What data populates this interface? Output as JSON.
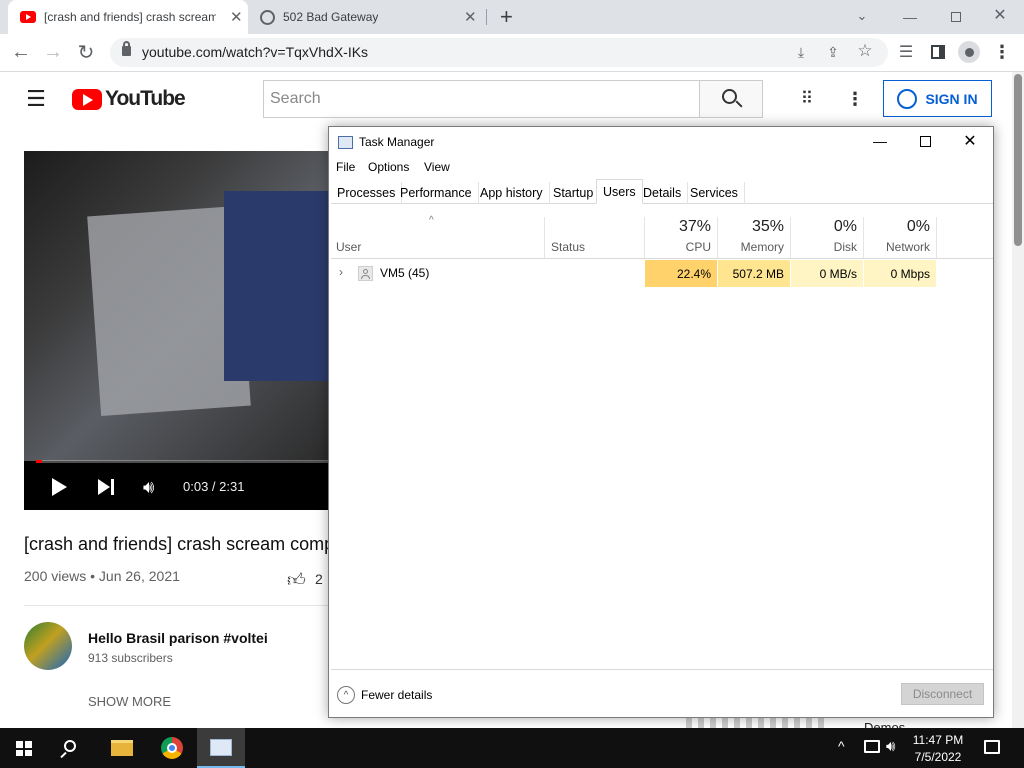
{
  "browser": {
    "tabs": [
      {
        "title": "[crash and friends] crash scream",
        "active": true
      },
      {
        "title": "502 Bad Gateway",
        "active": false
      }
    ],
    "new_tab": "+",
    "url": "youtube.com/watch?v=TqxVhdX-IKs"
  },
  "youtube": {
    "logo_text": "YouTube",
    "search_placeholder": "Search",
    "sign_in": "SIGN IN",
    "video": {
      "time": "0:03 / 2:31",
      "progress": 0.02,
      "title": "[crash and friends] crash scream comp",
      "meta": "200 views • Jun 26, 2021",
      "likes": "2"
    },
    "channel": {
      "name": "Hello Brasil parison #voltei",
      "subscribers": "913 subscribers"
    },
    "show_more": "SHOW MORE",
    "peek_text": "Demos"
  },
  "task_manager": {
    "title": "Task Manager",
    "menu": [
      "File",
      "Options",
      "View"
    ],
    "tabs": [
      "Processes",
      "Performance",
      "App history",
      "Startup",
      "Users",
      "Details",
      "Services"
    ],
    "active_tab": "Users",
    "columns": {
      "user": "User",
      "status": "Status",
      "cpu": {
        "pct": "37%",
        "label": "CPU"
      },
      "memory": {
        "pct": "35%",
        "label": "Memory"
      },
      "disk": {
        "pct": "0%",
        "label": "Disk"
      },
      "network": {
        "pct": "0%",
        "label": "Network"
      }
    },
    "rows": [
      {
        "user": "VM5 (45)",
        "status": "",
        "cpu": "22.4%",
        "memory": "507.2 MB",
        "disk": "0 MB/s",
        "network": "0 Mbps"
      }
    ],
    "fewer_details": "Fewer details",
    "disconnect": "Disconnect"
  },
  "taskbar": {
    "time": "11:47 PM",
    "date": "7/5/2022"
  },
  "colors": {
    "cpu_heat": "#ffd26b",
    "memory_heat": "#ffe58f",
    "light_heat": "#fff4c4",
    "youtube_red": "#ff0000",
    "link_blue": "#065fd4"
  }
}
